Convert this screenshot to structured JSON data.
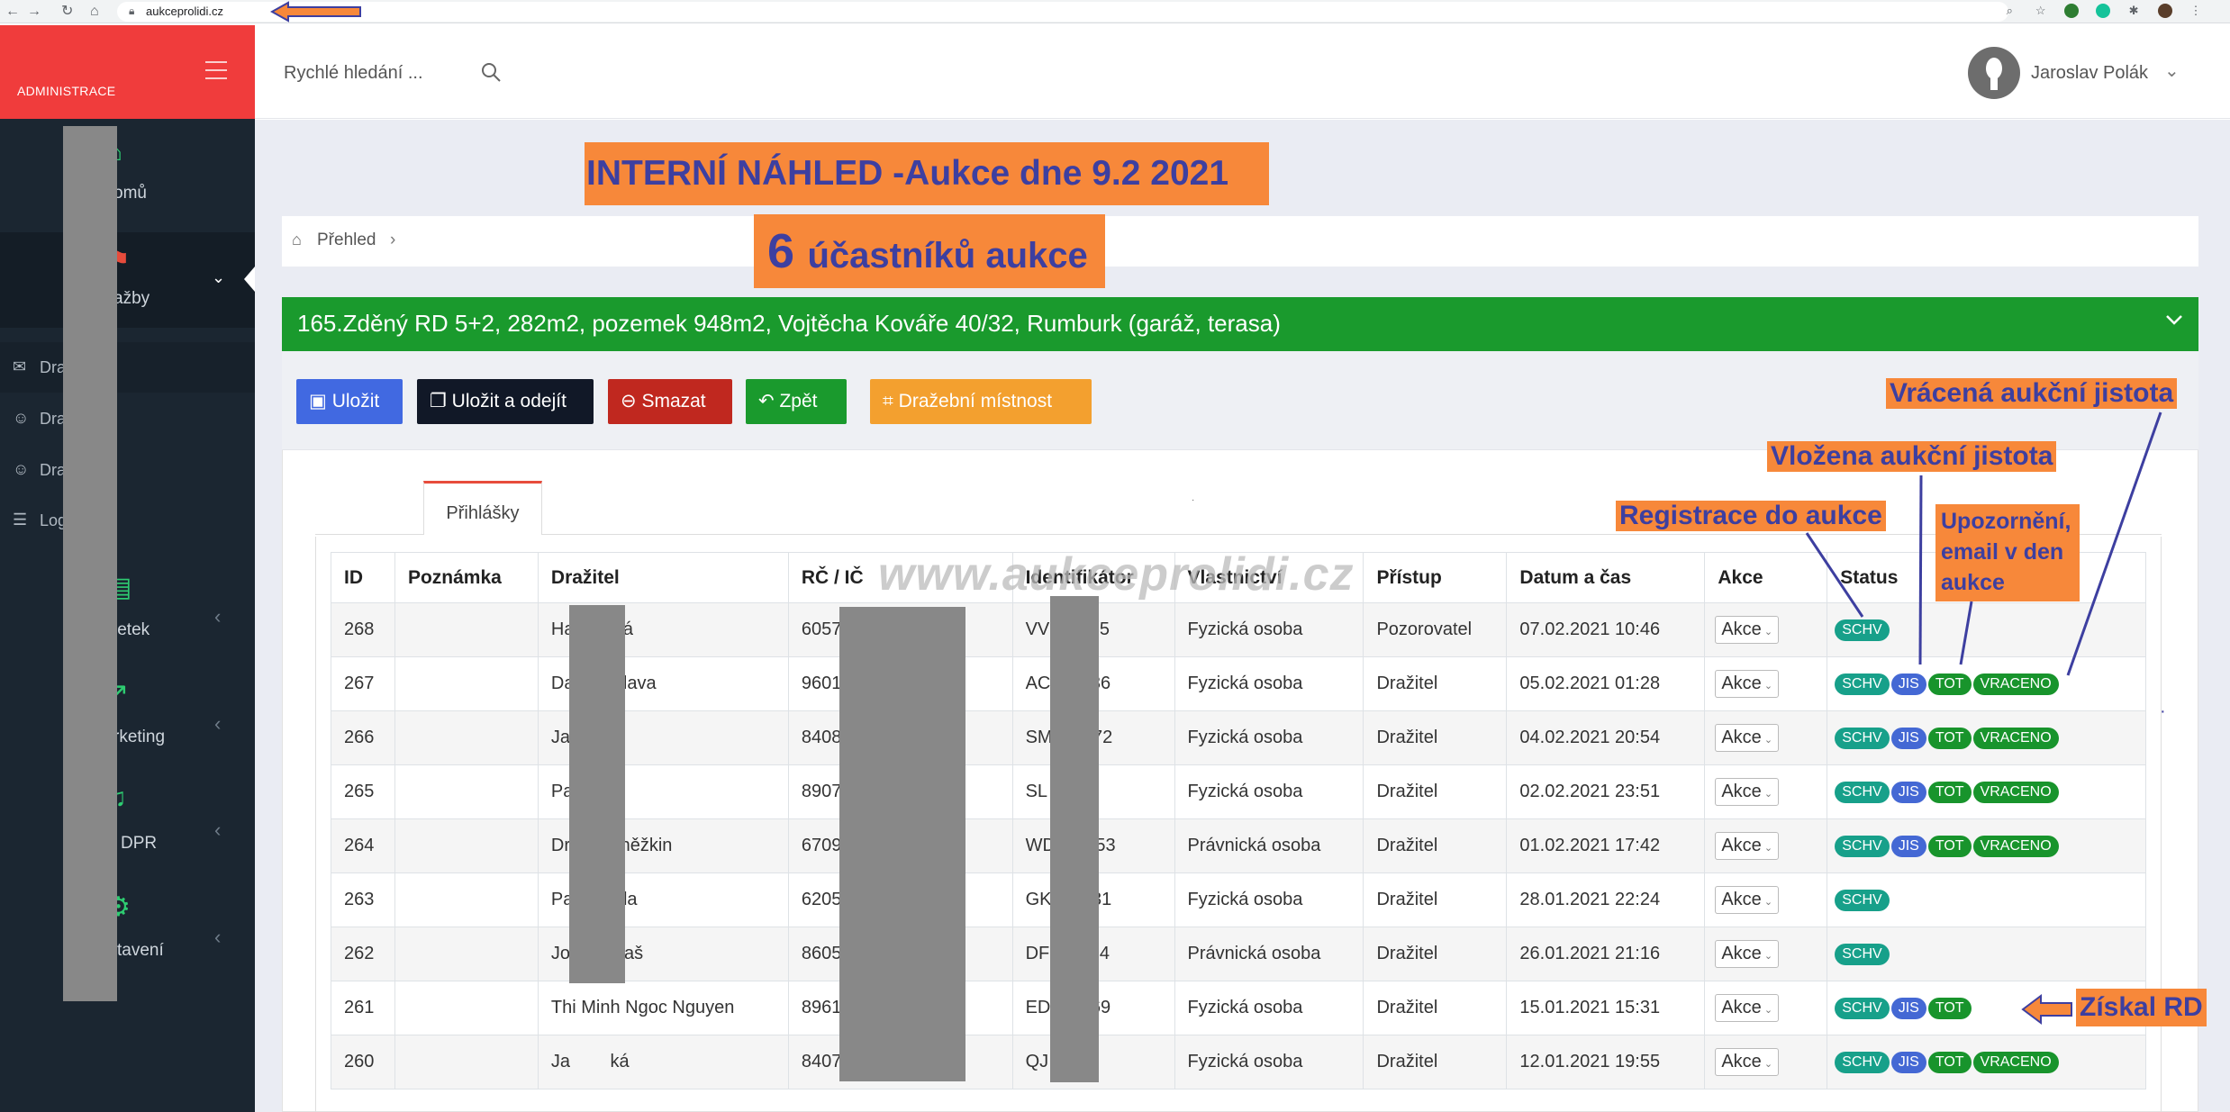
{
  "browser": {
    "url": "aukceprolidi.cz"
  },
  "sidebar": {
    "title": "ADMINISTRACE",
    "items": [
      {
        "label": "Domů",
        "visible": "omů",
        "icon": "home-icon"
      },
      {
        "label": "Dražby",
        "visible": "ažby",
        "icon": "gavel-icon"
      },
      {
        "label": "Majetek",
        "visible": "jetek",
        "icon": "building-icon"
      },
      {
        "label": "Marketing",
        "visible": "rketing",
        "icon": "chart-icon"
      },
      {
        "label": "GDPR",
        "visible": "DPR",
        "icon": "bell-icon"
      },
      {
        "label": "Nastavení",
        "visible": "tavení",
        "icon": "gear-icon"
      }
    ],
    "subitems": [
      "Dra",
      "Dra",
      "Dra   ci",
      "Log   ostí"
    ]
  },
  "header": {
    "search_placeholder": "Rychlé hledání ...",
    "user": "Jaroslav Polák"
  },
  "banner1": "INTERNÍ NÁHLED -Aukce dne 9.2 2021",
  "banner2": {
    "num": "6",
    "text": "účastníků aukce"
  },
  "breadcrumb": "Přehled",
  "panel_title": "165.Zděný RD 5+2, 282m2, pozemek 948m2, Vojtěcha Kováře 40/32, Rumburk (garáž, terasa)",
  "toolbar": {
    "save": "Uložit",
    "save_exit": "Uložit a odejít",
    "delete": "Smazat",
    "back": "Zpět",
    "room": "Dražební místnost"
  },
  "tab": "Přihlášky",
  "columns": [
    "ID",
    "Poznámka",
    "Dražitel",
    "RČ / IČ",
    "Identifikátor",
    "Vlastnictví",
    "Přístup",
    "Datum a čas",
    "Akce",
    "Status"
  ],
  "akce_label": "Akce",
  "rows": [
    {
      "id": "268",
      "drazitel": "Ha        ká",
      "rc": "60572",
      "ident": "VV        95",
      "vlastnictvi": "Fyzická osoba",
      "pristup": "Pozorovatel",
      "datum": "07.02.2021 10:46",
      "status": [
        "SCHV"
      ]
    },
    {
      "id": "267",
      "drazitel": "Da        slava",
      "rc": "9601",
      "ident": "AC        36",
      "vlastnictvi": "Fyzická osoba",
      "pristup": "Dražitel",
      "datum": "05.02.2021 01:28",
      "status": [
        "SCHV",
        "JIS",
        "TOT",
        "VRACENO"
      ]
    },
    {
      "id": "266",
      "drazitel": "Ja        l",
      "rc": "8408",
      "ident": "SM        72",
      "vlastnictvi": "Fyzická osoba",
      "pristup": "Dražitel",
      "datum": "04.02.2021 20:54",
      "status": [
        "SCHV",
        "JIS",
        "TOT",
        "VRACENO"
      ]
    },
    {
      "id": "265",
      "drazitel": "Pa        t",
      "rc": "8907",
      "ident": "SL        2",
      "vlastnictvi": "Fyzická osoba",
      "pristup": "Dražitel",
      "datum": "02.02.2021 23:51",
      "status": [
        "SCHV",
        "JIS",
        "TOT",
        "VRACENO"
      ]
    },
    {
      "id": "264",
      "drazitel": "Dr        eněžkin",
      "rc": "6709",
      "ident": "WD        53",
      "vlastnictvi": "Právnická osoba",
      "pristup": "Dražitel",
      "datum": "01.02.2021 17:42",
      "status": [
        "SCHV",
        "JIS",
        "TOT",
        "VRACENO"
      ]
    },
    {
      "id": "263",
      "drazitel": "Pa        ala",
      "rc": "6205",
      "ident": "GK        31",
      "vlastnictvi": "Fyzická osoba",
      "pristup": "Dražitel",
      "datum": "28.01.2021 22:24",
      "status": [
        "SCHV"
      ]
    },
    {
      "id": "262",
      "drazitel": "Jo        staš",
      "rc": "8605",
      "ident": "DF        34",
      "vlastnictvi": "Právnická osoba",
      "pristup": "Dražitel",
      "datum": "26.01.2021 21:16",
      "status": [
        "SCHV"
      ]
    },
    {
      "id": "261",
      "drazitel": "Thi Minh Ngoc Nguyen",
      "rc": "8961",
      "ident": "ED        69",
      "vlastnictvi": "Fyzická osoba",
      "pristup": "Dražitel",
      "datum": "15.01.2021 15:31",
      "status": [
        "SCHV",
        "JIS",
        "TOT"
      ]
    },
    {
      "id": "260",
      "drazitel": "Ja        ká",
      "rc": "8407",
      "ident": "QJ        7",
      "vlastnictvi": "Fyzická osoba",
      "pristup": "Dražitel",
      "datum": "12.01.2021 19:55",
      "status": [
        "SCHV",
        "JIS",
        "TOT",
        "VRACENO"
      ]
    }
  ],
  "watermark": "www.aukceprolidi.cz",
  "annotations": {
    "vracena": "Vrácená aukční jistota",
    "vlozena": "Vložena aukční jistota",
    "registrace": "Registrace do aukce",
    "upozorneni": "Upozornění, email v den aukce",
    "ziskal": "Získal RD"
  },
  "colors": {
    "accent_red": "#f03c3c",
    "sidebar": "#1b2631",
    "panel_green": "#1a9a2d",
    "annotation_orange": "#f7883a",
    "annotation_text": "#3d3fa0"
  }
}
